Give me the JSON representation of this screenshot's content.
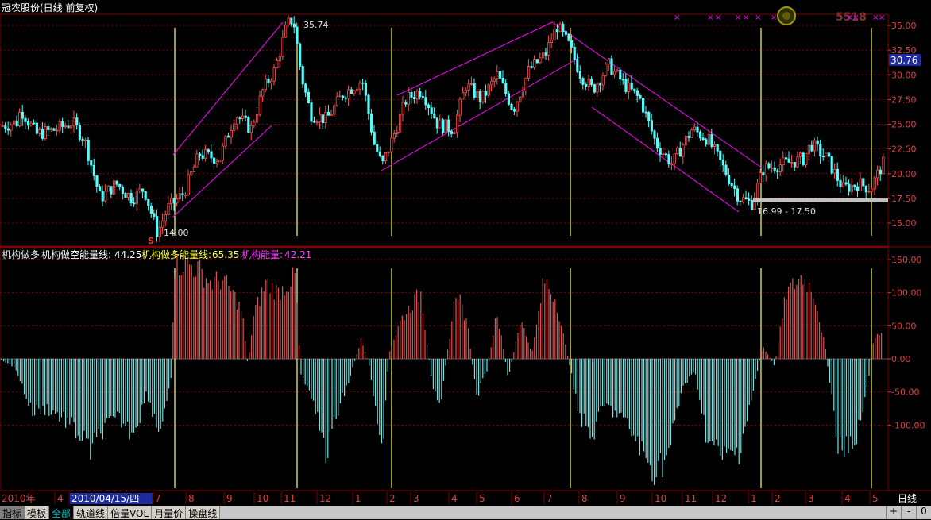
{
  "title": "冠农股份(日线 前复权)",
  "watermark": "5518",
  "current_price": "30.76",
  "price_axis_ticks": [
    "35.00",
    "32.50",
    "30.00",
    "27.50",
    "25.00",
    "22.50",
    "20.00",
    "17.50",
    "15.00"
  ],
  "annotations": {
    "high": "35.74",
    "low": "14.00",
    "range": "16.99 - 17.50",
    "signal": "S"
  },
  "indicator": {
    "name": "机构做多",
    "empty_label": "机构做空能量线:",
    "empty_value": "44.25",
    "long_label": "机构做多能量线:",
    "long_value": "65.35",
    "energy_label": "机构能量:",
    "energy_value": "42.21",
    "axis_ticks": [
      "150.00",
      "100.00",
      "50.00",
      "0.00",
      "-50.00",
      "-100.00"
    ]
  },
  "time_axis": {
    "labels": [
      "2010年",
      "4",
      "2010/04/15/四",
      "7",
      "8",
      "9",
      "10",
      "11",
      "12",
      "1",
      "2",
      "3",
      "4",
      "5",
      "6",
      "7",
      "8",
      "9",
      "10",
      "11",
      "12",
      "1",
      "2",
      "3",
      "4",
      "5"
    ],
    "period": "日线"
  },
  "tabs": [
    "指标",
    "模板",
    "全部",
    "轨道线",
    "倍量VOL",
    "月量价",
    "操盘线"
  ],
  "nav_buttons": [
    "+",
    "-",
    "0"
  ],
  "colors": {
    "up": "#ff5050",
    "down": "#54fcfc",
    "channel": "#ff00ff",
    "vline": "#ffff66",
    "grid": "#800000"
  },
  "chart_data": {
    "type": "candlestick",
    "note_series": [
      "price",
      "institutional energy histogram"
    ],
    "price_range": [
      14.0,
      35.74
    ],
    "ylim_price": [
      13.5,
      36.5
    ],
    "ylim_indicator": [
      -145,
      160
    ],
    "price_path": [
      [
        0,
        24.8
      ],
      [
        20,
        25.2
      ],
      [
        25,
        26.5
      ],
      [
        45,
        24.0
      ],
      [
        70,
        24.5
      ],
      [
        90,
        25.2
      ],
      [
        105,
        23.5
      ],
      [
        125,
        17.5
      ],
      [
        145,
        19.0
      ],
      [
        165,
        17.5
      ],
      [
        180,
        18.5
      ],
      [
        197,
        14.0
      ],
      [
        210,
        16.5
      ],
      [
        230,
        18.0
      ],
      [
        250,
        22.0
      ],
      [
        275,
        21.5
      ],
      [
        295,
        26.0
      ],
      [
        315,
        24.5
      ],
      [
        330,
        28.5
      ],
      [
        345,
        30.5
      ],
      [
        360,
        35.0
      ],
      [
        368,
        35.74
      ],
      [
        378,
        30.0
      ],
      [
        390,
        26.0
      ],
      [
        410,
        25.5
      ],
      [
        430,
        28.0
      ],
      [
        455,
        29.5
      ],
      [
        470,
        23.0
      ],
      [
        480,
        20.8
      ],
      [
        495,
        24.0
      ],
      [
        510,
        27.5
      ],
      [
        530,
        28.5
      ],
      [
        550,
        25.0
      ],
      [
        570,
        24.5
      ],
      [
        585,
        29.0
      ],
      [
        605,
        27.5
      ],
      [
        625,
        30.0
      ],
      [
        645,
        26.5
      ],
      [
        665,
        30.5
      ],
      [
        685,
        32.0
      ],
      [
        700,
        35.0
      ],
      [
        715,
        33.0
      ],
      [
        730,
        30.0
      ],
      [
        745,
        28.5
      ],
      [
        765,
        31.0
      ],
      [
        785,
        29.0
      ],
      [
        805,
        27.5
      ],
      [
        825,
        23.0
      ],
      [
        845,
        21.0
      ],
      [
        870,
        24.5
      ],
      [
        890,
        23.5
      ],
      [
        910,
        20.5
      ],
      [
        930,
        17.5
      ],
      [
        945,
        17.0
      ],
      [
        960,
        20.5
      ],
      [
        985,
        21.0
      ],
      [
        1010,
        21.5
      ],
      [
        1020,
        23.0
      ],
      [
        1040,
        21.5
      ],
      [
        1060,
        18.5
      ],
      [
        1080,
        19.0
      ],
      [
        1095,
        18.5
      ],
      [
        1110,
        21.0
      ]
    ],
    "indicator_path": [
      [
        0,
        0
      ],
      [
        20,
        -15
      ],
      [
        40,
        -80
      ],
      [
        60,
        -75
      ],
      [
        80,
        -90
      ],
      [
        100,
        -115
      ],
      [
        115,
        -140
      ],
      [
        130,
        -105
      ],
      [
        150,
        -90
      ],
      [
        165,
        -110
      ],
      [
        175,
        -90
      ],
      [
        185,
        -50
      ],
      [
        200,
        -110
      ],
      [
        215,
        -40
      ],
      [
        220,
        140
      ],
      [
        235,
        145
      ],
      [
        250,
        135
      ],
      [
        265,
        115
      ],
      [
        280,
        120
      ],
      [
        295,
        95
      ],
      [
        305,
        70
      ],
      [
        312,
        -10
      ],
      [
        320,
        70
      ],
      [
        335,
        115
      ],
      [
        350,
        100
      ],
      [
        360,
        110
      ],
      [
        372,
        125
      ],
      [
        378,
        -20
      ],
      [
        395,
        -60
      ],
      [
        410,
        -150
      ],
      [
        425,
        -80
      ],
      [
        440,
        -30
      ],
      [
        455,
        30
      ],
      [
        465,
        -10
      ],
      [
        480,
        -155
      ],
      [
        490,
        10
      ],
      [
        505,
        60
      ],
      [
        520,
        85
      ],
      [
        530,
        100
      ],
      [
        545,
        -50
      ],
      [
        555,
        -60
      ],
      [
        575,
        110
      ],
      [
        590,
        40
      ],
      [
        600,
        -60
      ],
      [
        615,
        -10
      ],
      [
        625,
        75
      ],
      [
        640,
        -30
      ],
      [
        655,
        60
      ],
      [
        670,
        10
      ],
      [
        685,
        120
      ],
      [
        700,
        90
      ],
      [
        716,
        -5
      ],
      [
        730,
        -85
      ],
      [
        745,
        -120
      ],
      [
        760,
        -70
      ],
      [
        780,
        -85
      ],
      [
        800,
        -120
      ],
      [
        820,
        -170
      ],
      [
        840,
        -150
      ],
      [
        860,
        -40
      ],
      [
        875,
        -20
      ],
      [
        890,
        -120
      ],
      [
        910,
        -150
      ],
      [
        930,
        -140
      ],
      [
        950,
        -40
      ],
      [
        960,
        20
      ],
      [
        975,
        -10
      ],
      [
        990,
        100
      ],
      [
        1010,
        125
      ],
      [
        1025,
        100
      ],
      [
        1040,
        10
      ],
      [
        1055,
        -140
      ],
      [
        1075,
        -130
      ],
      [
        1090,
        -60
      ],
      [
        1100,
        30
      ],
      [
        1110,
        40
      ]
    ],
    "series": [
      {
        "name": "机构做空能量线",
        "value": 44.25
      },
      {
        "name": "机构做多能量线",
        "value": 65.35
      },
      {
        "name": "机构能量",
        "value": 42.21
      }
    ]
  }
}
